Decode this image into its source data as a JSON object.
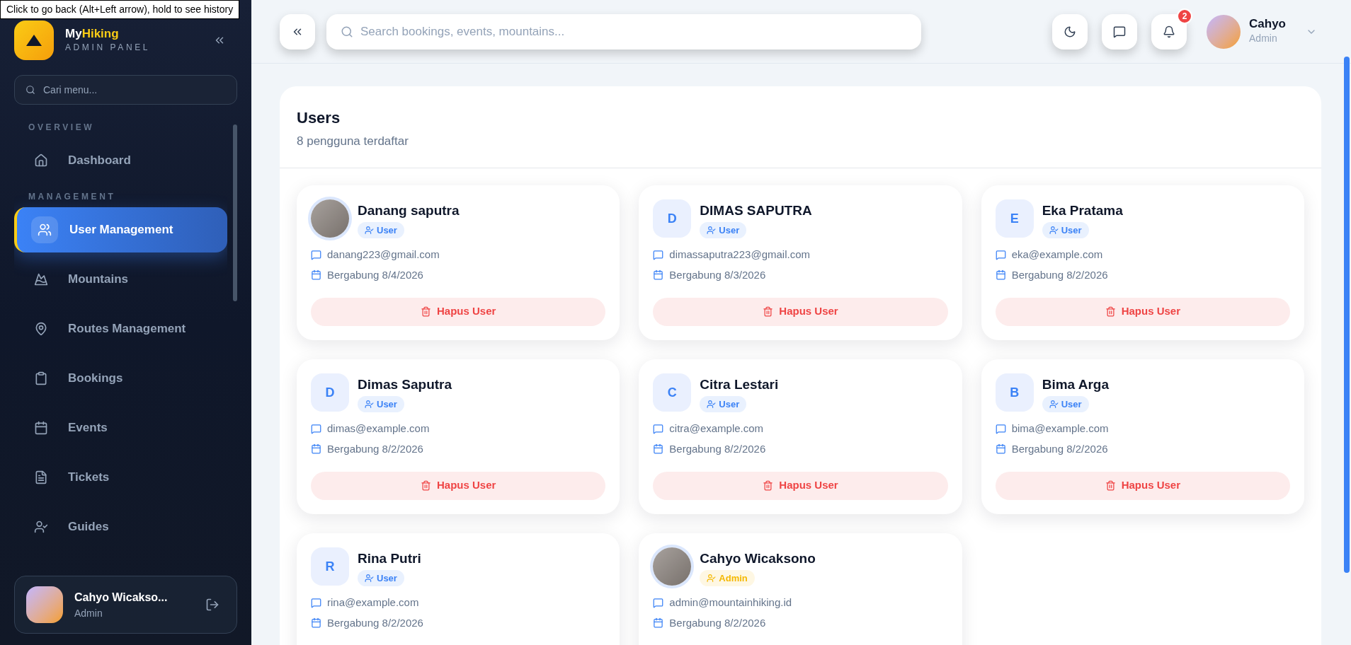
{
  "tooltip": "Click to go back (Alt+Left arrow), hold to see history",
  "brand": {
    "name_part1": "My",
    "name_part2": "Hiking",
    "subtitle": "ADMIN PANEL"
  },
  "sidebar": {
    "search_placeholder": "Cari menu...",
    "sections": [
      {
        "title": "OVERVIEW",
        "items": [
          {
            "label": "Dashboard",
            "selected": false
          }
        ]
      },
      {
        "title": "MANAGEMENT",
        "items": [
          {
            "label": "User Management",
            "selected": true
          },
          {
            "label": "Mountains",
            "selected": false
          },
          {
            "label": "Routes Management",
            "selected": false
          },
          {
            "label": "Bookings",
            "selected": false
          },
          {
            "label": "Events",
            "selected": false
          },
          {
            "label": "Tickets",
            "selected": false
          },
          {
            "label": "Guides",
            "selected": false
          }
        ]
      }
    ],
    "profile": {
      "name": "Cahyo Wicakso...",
      "role": "Admin"
    }
  },
  "header": {
    "search_placeholder": "Search bookings, events, mountains...",
    "notification_count": "2",
    "user": {
      "name": "Cahyo",
      "role": "Admin"
    }
  },
  "users_panel": {
    "title": "Users",
    "subtitle": "8 pengguna terdaftar",
    "users": [
      {
        "name": "Danang saputra",
        "role": "User",
        "color": "#3b82f6",
        "email": "danang223@gmail.com",
        "joined": "Bergabung 8/4/2026",
        "delete_label": "Hapus User"
      },
      {
        "name": "DIMAS SAPUTRA",
        "initial": "D",
        "role": "User",
        "color": "#3b82f6",
        "email": "dimassaputra223@gmail.com",
        "joined": "Bergabung 8/3/2026",
        "delete_label": "Hapus User"
      },
      {
        "name": "Eka Pratama",
        "initial": "E",
        "role": "User",
        "color": "#3b82f6",
        "email": "eka@example.com",
        "joined": "Bergabung 8/2/2026",
        "delete_label": "Hapus User"
      },
      {
        "name": "Dimas Saputra",
        "initial": "D",
        "role": "User",
        "color": "#3b82f6",
        "email": "dimas@example.com",
        "joined": "Bergabung 8/2/2026",
        "delete_label": "Hapus User"
      },
      {
        "name": "Citra Lestari",
        "initial": "C",
        "role": "User",
        "color": "#3b82f6",
        "email": "citra@example.com",
        "joined": "Bergabung 8/2/2026",
        "delete_label": "Hapus User"
      },
      {
        "name": "Bima Arga",
        "initial": "B",
        "role": "User",
        "color": "#3b82f6",
        "email": "bima@example.com",
        "joined": "Bergabung 8/2/2026",
        "delete_label": "Hapus User"
      },
      {
        "name": "Rina Putri",
        "initial": "R",
        "role": "User",
        "color": "#3b82f6",
        "email": "rina@example.com",
        "joined": "Bergabung 8/2/2026"
      },
      {
        "name": "Cahyo Wicaksono",
        "role": "Admin",
        "color": "#f5b800",
        "email": "admin@mountainhiking.id",
        "joined": "Bergabung 8/2/2026"
      }
    ]
  }
}
